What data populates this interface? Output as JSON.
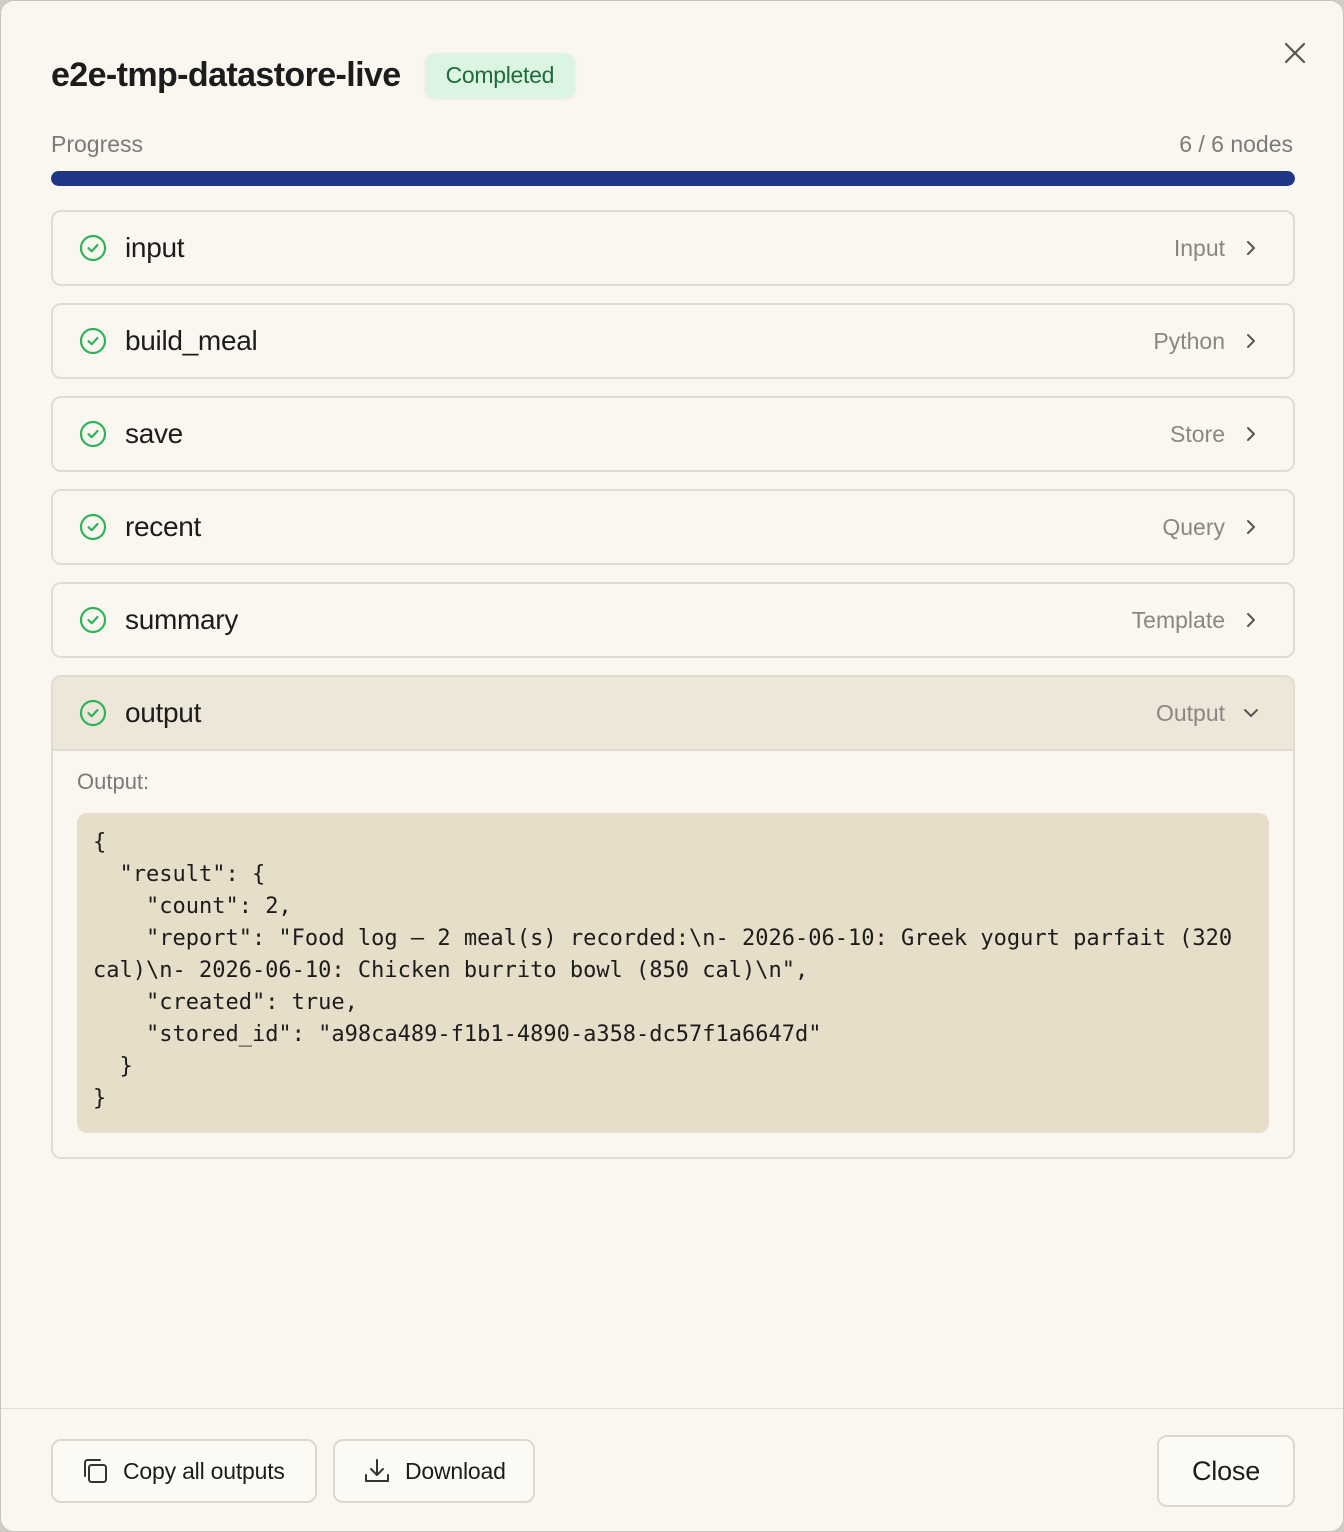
{
  "dialog": {
    "title": "e2e-tmp-datastore-live",
    "status": "Completed"
  },
  "progress": {
    "label": "Progress",
    "count_text": "6 / 6 nodes",
    "fraction": 1.0
  },
  "colors": {
    "progress_fill": "#1f3585",
    "success_green": "#2fb35a",
    "badge_bg": "#dcf5e3"
  },
  "nodes": [
    {
      "name": "input",
      "type": "Input",
      "status_icon": "check-circle-icon",
      "expanded": false
    },
    {
      "name": "build_meal",
      "type": "Python",
      "status_icon": "check-circle-icon",
      "expanded": false
    },
    {
      "name": "save",
      "type": "Store",
      "status_icon": "check-circle-icon",
      "expanded": false
    },
    {
      "name": "recent",
      "type": "Query",
      "status_icon": "check-circle-icon",
      "expanded": false
    },
    {
      "name": "summary",
      "type": "Template",
      "status_icon": "check-circle-icon",
      "expanded": false
    },
    {
      "name": "output",
      "type": "Output",
      "status_icon": "check-circle-icon",
      "expanded": true
    }
  ],
  "output_panel": {
    "label": "Output:",
    "code": "{\n  \"result\": {\n    \"count\": 2,\n    \"report\": \"Food log — 2 meal(s) recorded:\\n- 2026-06-10: Greek yogurt parfait (320 cal)\\n- 2026-06-10: Chicken burrito bowl (850 cal)\\n\",\n    \"created\": true,\n    \"stored_id\": \"a98ca489-f1b1-4890-a358-dc57f1a6647d\"\n  }\n}"
  },
  "footer": {
    "copy_label": "Copy all outputs",
    "download_label": "Download",
    "close_label": "Close"
  }
}
